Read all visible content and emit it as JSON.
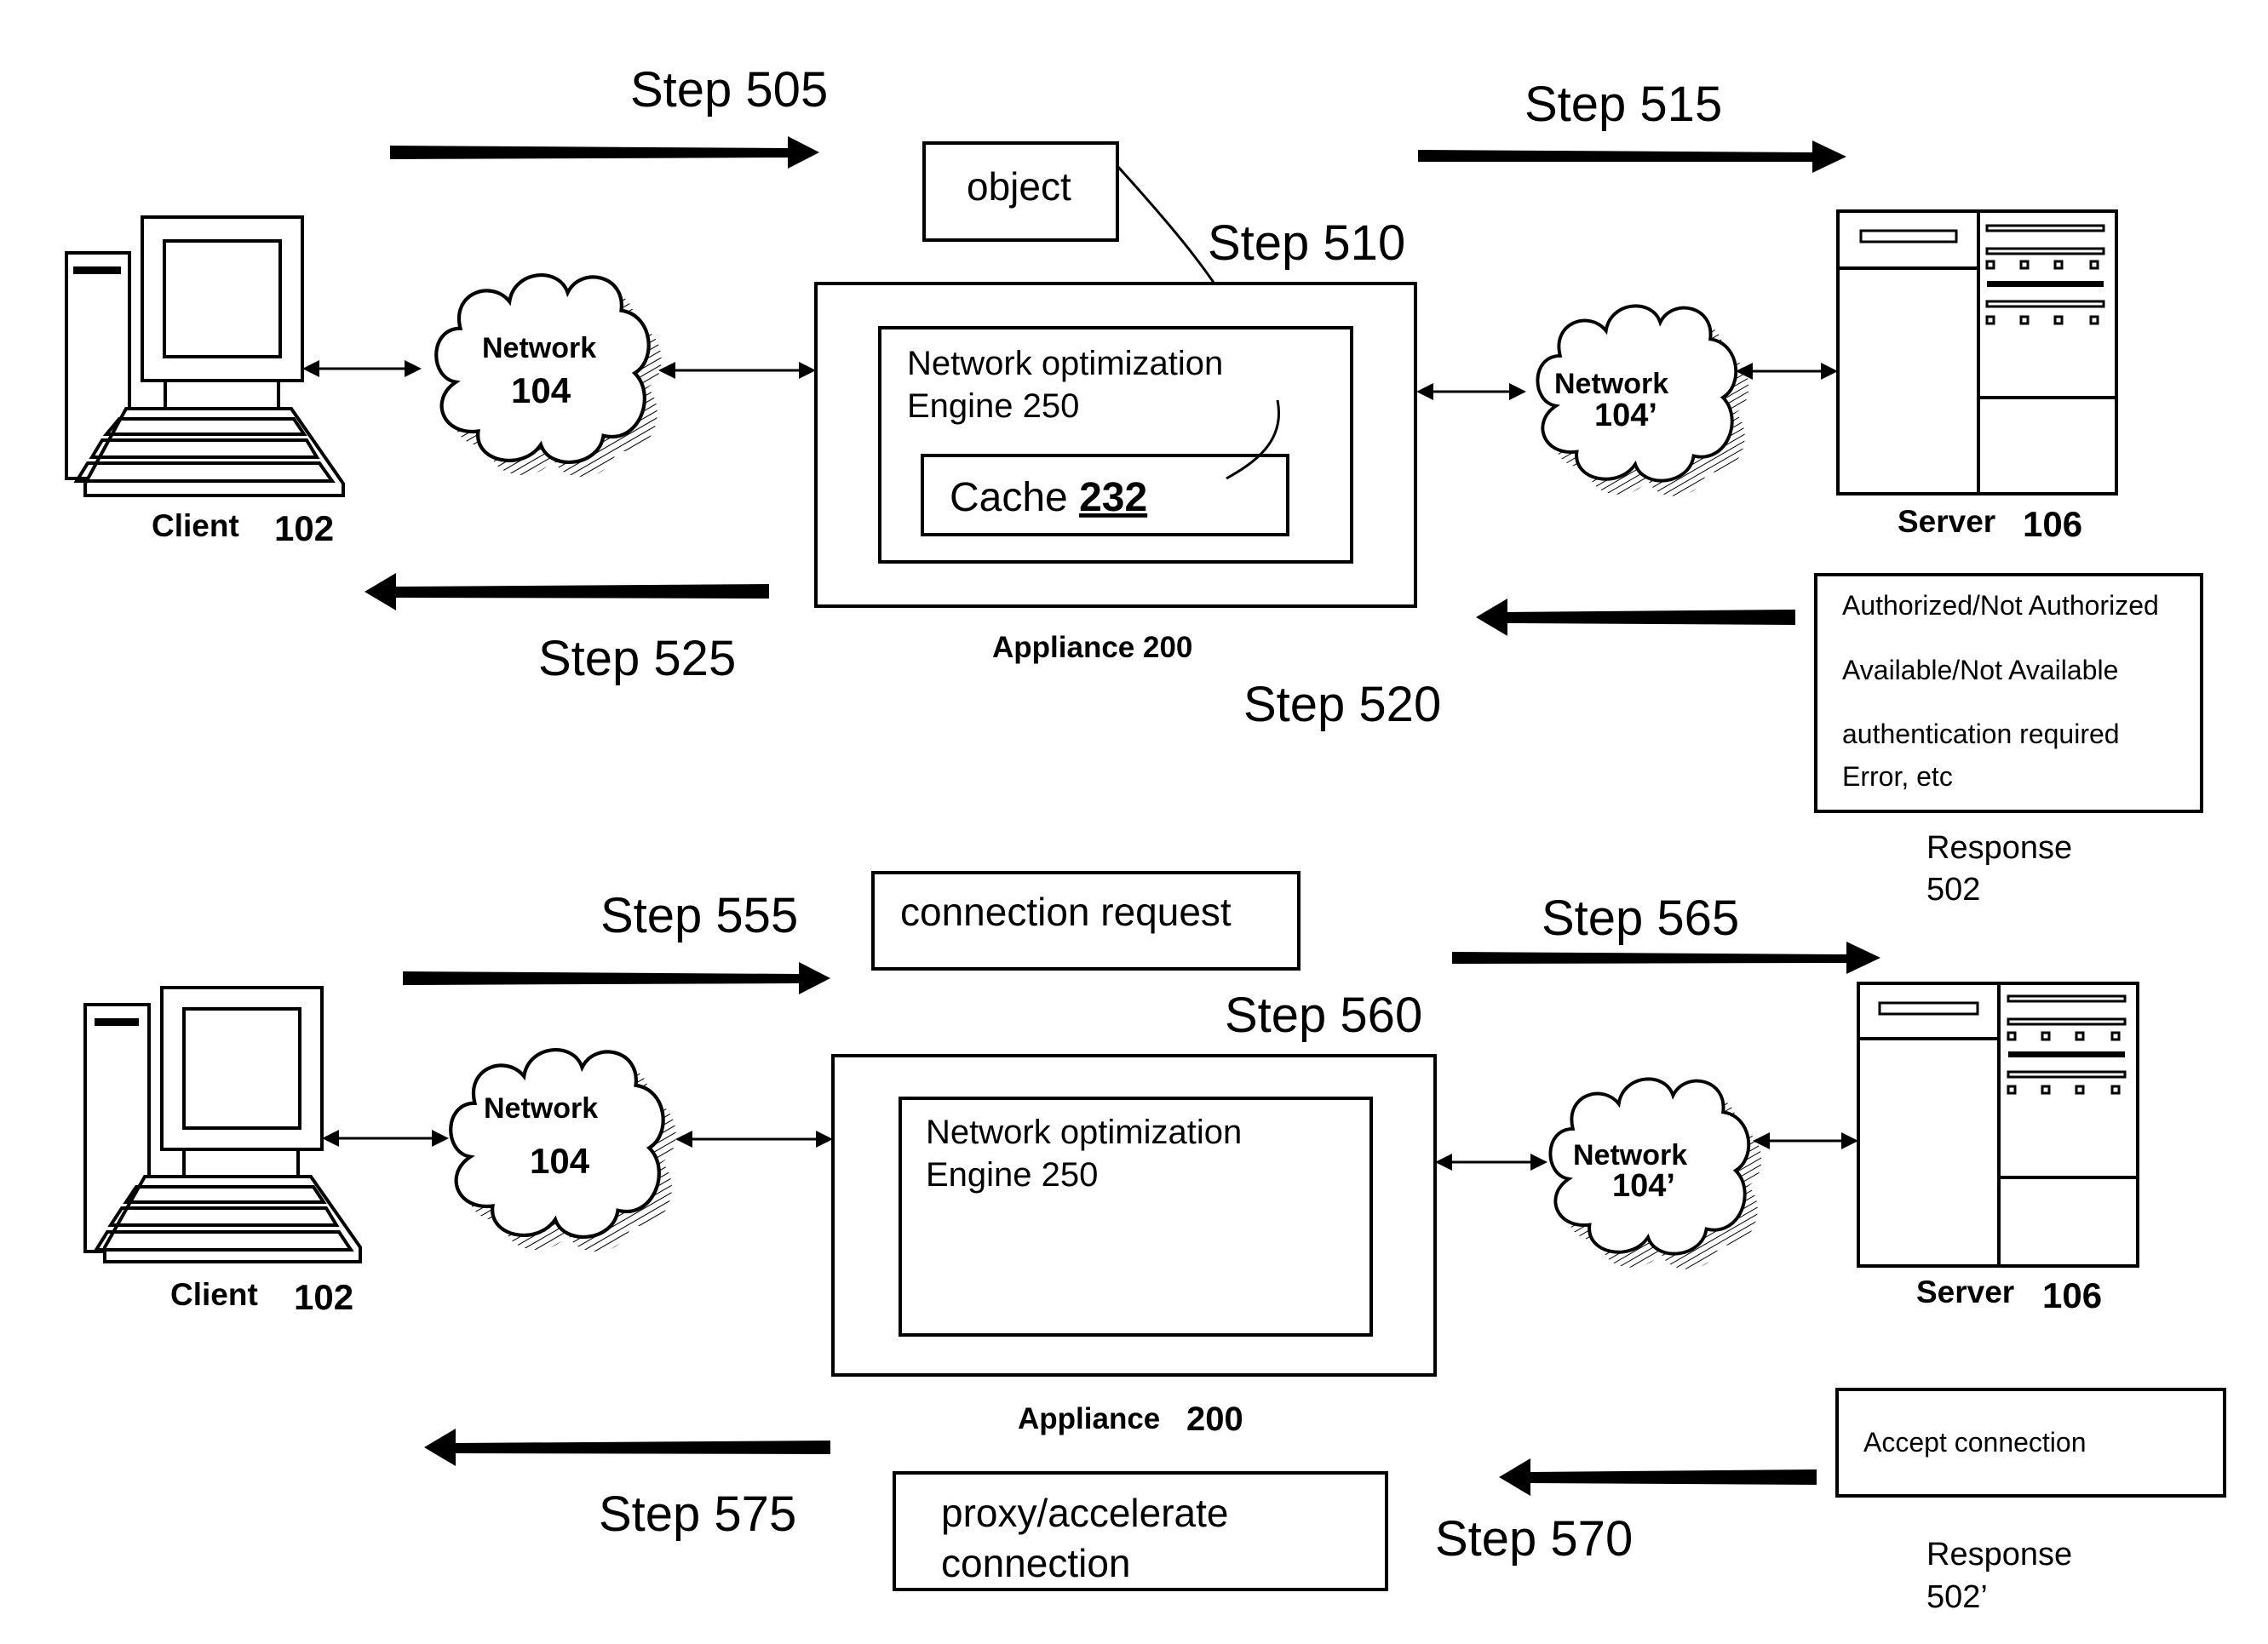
{
  "figure": {
    "top": {
      "steps": {
        "s505": "Step 505",
        "s510": "Step 510",
        "s515": "Step 515",
        "s520": "Step 520",
        "s525": "Step 525"
      },
      "object_label": "object",
      "client_label": "Client",
      "client_id": "102",
      "network1_label": "Network",
      "network1_id": "104",
      "network2_label": "Network",
      "network2_id": "104’",
      "engine_line1": "Network optimization",
      "engine_line2": "Engine 250",
      "cache_label": "Cache ",
      "cache_id": "232",
      "appliance_label": "Appliance 200",
      "server_label": "Server",
      "server_id": "106",
      "response_lines": [
        "Authorized/Not Authorized",
        "Available/Not  Available",
        "authentication required",
        "Error, etc"
      ],
      "response_label": "Response",
      "response_id": "502"
    },
    "bottom": {
      "steps": {
        "s555": "Step 555",
        "s560": "Step 560",
        "s565": "Step 565",
        "s570": "Step 570",
        "s575": "Step 575"
      },
      "connection_request_label": "connection request",
      "client_label": "Client",
      "client_id": "102",
      "network1_label": "Network",
      "network1_id": "104",
      "network2_label": "Network",
      "network2_id": "104’",
      "engine_line1": "Network optimization",
      "engine_line2": "Engine 250",
      "appliance_label": "Appliance",
      "appliance_id": "200",
      "server_label": "Server",
      "server_id": "106",
      "accept_label": "Accept  connection",
      "proxy_line1": "proxy/accelerate",
      "proxy_line2": "connection",
      "response_label": "Response",
      "response_id": "502’"
    }
  }
}
